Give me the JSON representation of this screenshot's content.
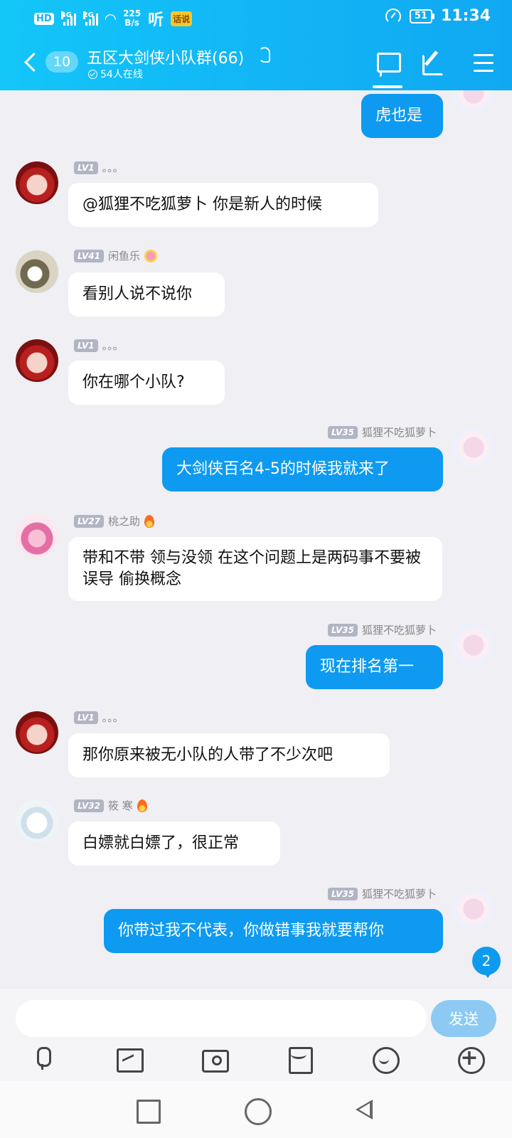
{
  "status_bar": {
    "hd_label": "HD",
    "sim1_label": "4G",
    "sim2_label": "2G",
    "speed_value": "225",
    "speed_unit": "B/s",
    "ting_label": "听",
    "badge_label": "话说",
    "battery": "51",
    "time": "11:34"
  },
  "header": {
    "unread_count": "10",
    "group_title": "五区大剑侠小队群(66)",
    "online_text": "54人在线"
  },
  "messages": [
    {
      "dir": "out",
      "name": "",
      "level": "",
      "text": "虎也是"
    },
    {
      "dir": "in",
      "name": "。。。",
      "level": "LV1",
      "text": "@狐狸不吃狐萝卜 你是新人的时候"
    },
    {
      "dir": "in",
      "name": "闲鱼乐",
      "level": "LV41",
      "text": "看别人说不说你"
    },
    {
      "dir": "in",
      "name": "。。。",
      "level": "LV1",
      "text": "你在哪个小队?"
    },
    {
      "dir": "out",
      "name": "狐狸不吃狐萝卜",
      "level": "LV35",
      "text": "大剑侠百名4-5的时候我就来了"
    },
    {
      "dir": "in",
      "name": "桃之助",
      "level": "LV27",
      "text": "带和不带 领与没领 在这个问题上是两码事不要被误导 偷换概念"
    },
    {
      "dir": "out",
      "name": "狐狸不吃狐萝卜",
      "level": "LV35",
      "text": "现在排名第一"
    },
    {
      "dir": "in",
      "name": "。。。",
      "level": "LV1",
      "text": "那你原来被无小队的人带了不少次吧"
    },
    {
      "dir": "in",
      "name": "筱 寒",
      "level": "LV32",
      "text": "白嫖就白嫖了，很正常"
    },
    {
      "dir": "out",
      "name": "狐狸不吃狐萝卜",
      "level": "LV35",
      "text": "你带过我不代表，你做错事我就要帮你"
    }
  ],
  "new_message_count": "2",
  "input": {
    "placeholder": "",
    "send_label": "发送"
  },
  "colors": {
    "header_gradient_start": "#13c6f8",
    "header_gradient_end": "#10a8f2",
    "outgoing_bubble": "#0e9af0",
    "incoming_bubble": "#ffffff",
    "background": "#efeff4",
    "send_button": "#8ccaf4"
  }
}
